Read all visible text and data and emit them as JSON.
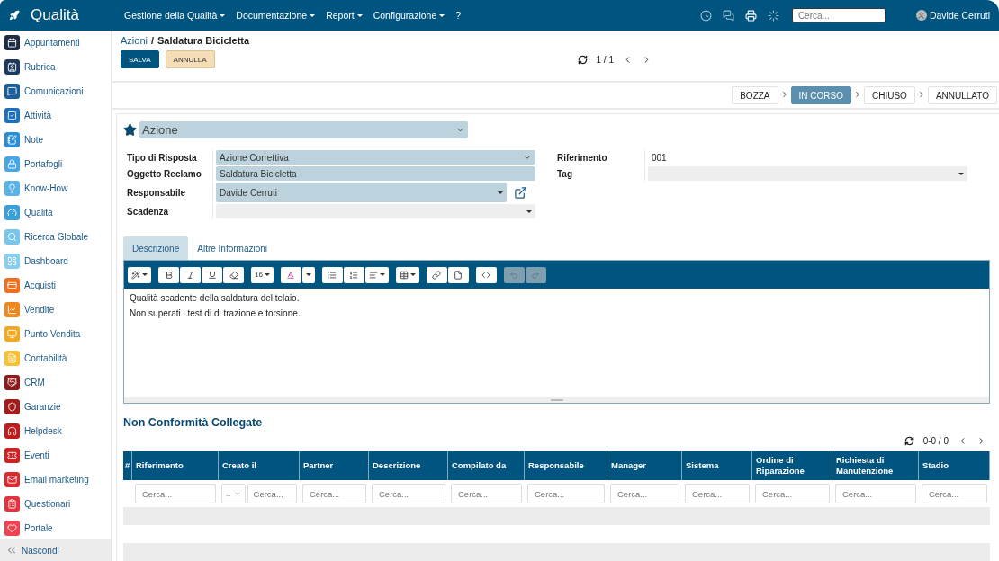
{
  "app": {
    "title": "Qualità"
  },
  "menu": [
    {
      "label": "Gestione della Qualità",
      "caret": true
    },
    {
      "label": "Documentazione",
      "caret": true
    },
    {
      "label": "Report",
      "caret": true
    },
    {
      "label": "Configurazione",
      "caret": true
    },
    {
      "label": "?",
      "caret": false
    }
  ],
  "topbar": {
    "search": {
      "placeholder": "Cerca..."
    },
    "user": "Davide Cerruti"
  },
  "sidebar": {
    "items": [
      {
        "label": "Appuntamenti",
        "color": "#1f2b45"
      },
      {
        "label": "Rubrica",
        "color": "#1d3a5c"
      },
      {
        "label": "Comunicazioni",
        "color": "#1b5e9c"
      },
      {
        "label": "Attività",
        "color": "#1f6fbf"
      },
      {
        "label": "Note",
        "color": "#2a8ed6"
      },
      {
        "label": "Portafogli",
        "color": "#47a6e6"
      },
      {
        "label": "Know-How",
        "color": "#58b4e6"
      },
      {
        "label": "Qualità",
        "color": "#3a9fd8"
      },
      {
        "label": "Ricerca Globale",
        "color": "#79c6ea"
      },
      {
        "label": "Dashboard",
        "color": "#86ceef"
      },
      {
        "label": "Acquisti",
        "color": "#ee6f1f"
      },
      {
        "label": "Vendite",
        "color": "#f08822"
      },
      {
        "label": "Punto Vendita",
        "color": "#f3a821"
      },
      {
        "label": "Contabilità",
        "color": "#f6c133"
      },
      {
        "label": "CRM",
        "color": "#8b1a1a"
      },
      {
        "label": "Garanzie",
        "color": "#a11c1c"
      },
      {
        "label": "Helpdesk",
        "color": "#bf1d1d"
      },
      {
        "label": "Eventi",
        "color": "#cf2121"
      },
      {
        "label": "Email marketing",
        "color": "#de2a2f"
      },
      {
        "label": "Questionari",
        "color": "#e6313e"
      },
      {
        "label": "Portale",
        "color": "#ee4350"
      }
    ],
    "collapse": "Nascondi"
  },
  "breadcrumb": {
    "parent": "Azioni",
    "separator": "/",
    "current": "Saldatura Bicicletta"
  },
  "actions": [
    {
      "label": "SALVA",
      "kind": "primary"
    },
    {
      "label": "ANNULLA",
      "kind": "secondary"
    }
  ],
  "pager": {
    "text": "1 / 1"
  },
  "stages": [
    {
      "label": "BOZZA",
      "selected": false
    },
    {
      "label": "IN CORSO",
      "selected": true
    },
    {
      "label": "CHIUSO",
      "selected": false
    },
    {
      "label": "ANNULLATO",
      "selected": false
    }
  ],
  "form": {
    "type_select": "Azione",
    "left_fields": [
      {
        "label": "Tipo di Risposta",
        "value": "Azione Correttiva",
        "kind": "select"
      },
      {
        "label": "Oggetto Reclamo",
        "value": "Saldatura Bicicletta",
        "kind": "text"
      },
      {
        "label": "Responsabile",
        "value": "Davide Cerruti",
        "kind": "link"
      },
      {
        "label": "Scadenza",
        "kind": "empty"
      }
    ],
    "right_fields": [
      {
        "label": "Riferimento",
        "value": "001",
        "kind": "plain"
      },
      {
        "label": "Tag",
        "kind": "empty"
      }
    ]
  },
  "tabs": [
    {
      "label": "Descrizione",
      "selected": true
    },
    {
      "label": "Altre Informazioni",
      "selected": false
    }
  ],
  "editor": {
    "toolbar": [
      [
        {
          "kind": "magic",
          "caret": true,
          "disabled": false
        }
      ],
      [
        {
          "kind": "bold",
          "disabled": false
        },
        {
          "kind": "italic",
          "disabled": false
        },
        {
          "kind": "underline",
          "disabled": false
        },
        {
          "kind": "eraser",
          "disabled": false
        }
      ],
      [
        {
          "kind": "size",
          "label": "16",
          "caret": true,
          "disabled": false
        }
      ],
      [
        {
          "kind": "color",
          "disabled": false
        },
        {
          "kind": "caret",
          "disabled": false
        }
      ],
      [
        {
          "kind": "ul",
          "disabled": false
        },
        {
          "kind": "ol",
          "disabled": false
        },
        {
          "kind": "align",
          "caret": true,
          "disabled": false
        }
      ],
      [
        {
          "kind": "table",
          "caret": true,
          "disabled": false
        }
      ],
      [
        {
          "kind": "link",
          "disabled": false
        },
        {
          "kind": "file",
          "disabled": false
        }
      ],
      [
        {
          "kind": "code",
          "disabled": false
        }
      ],
      [
        {
          "kind": "undo",
          "disabled": true
        },
        {
          "kind": "redo",
          "disabled": true
        }
      ]
    ],
    "lines": [
      "Qualità scadente della saldatura del telaio.",
      "Non superati i test di di trazione e torsione."
    ]
  },
  "related": {
    "title": "Non Conformità Collegate",
    "pager": "0-0 / 0",
    "columns": [
      {
        "label": "#"
      },
      {
        "label": "Riferimento",
        "placeholder": "Cerca..."
      },
      {
        "label": "Creato il",
        "placeholder": "Cerca...",
        "operator": "="
      },
      {
        "label": "Partner",
        "placeholder": "Cerca..."
      },
      {
        "label": "Descrizione",
        "placeholder": "Cerca..."
      },
      {
        "label": "Compilato da",
        "placeholder": "Cerca..."
      },
      {
        "label": "Responsabile",
        "placeholder": "Cerca..."
      },
      {
        "label": "Manager",
        "placeholder": "Cerca..."
      },
      {
        "label": "Sistema",
        "placeholder": "Cerca..."
      },
      {
        "label": "Ordine di Riparazione",
        "placeholder": "Cerca..."
      },
      {
        "label": "Richiesta di Manutenzione",
        "placeholder": "Cerca..."
      },
      {
        "label": "Stadio",
        "placeholder": "Cerca..."
      }
    ]
  }
}
